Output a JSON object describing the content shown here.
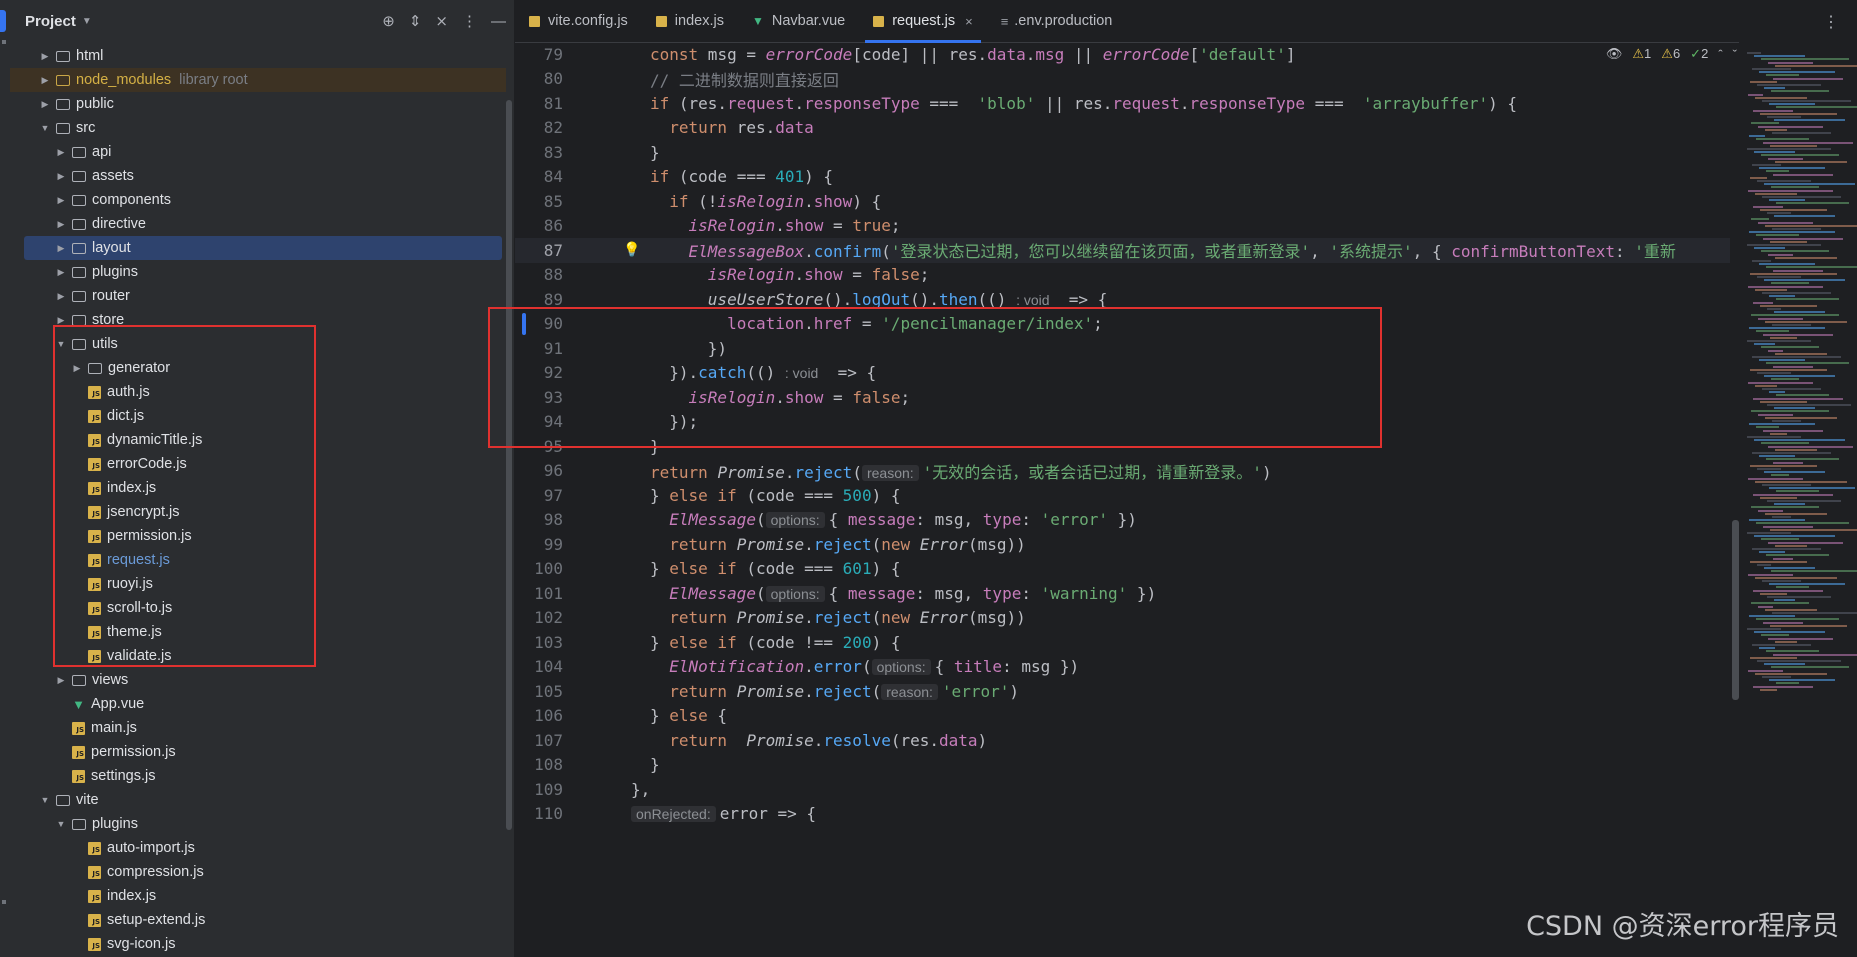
{
  "project": {
    "title": "Project",
    "tree": [
      {
        "name": "html",
        "type": "folder",
        "depth": 1,
        "arrow": "collapsed"
      },
      {
        "name": "node_modules",
        "type": "folder",
        "depth": 1,
        "arrow": "collapsed",
        "extra": "library root",
        "special": "nm"
      },
      {
        "name": "public",
        "type": "folder",
        "depth": 1,
        "arrow": "collapsed"
      },
      {
        "name": "src",
        "type": "folder",
        "depth": 1,
        "arrow": "expanded"
      },
      {
        "name": "api",
        "type": "folder",
        "depth": 2,
        "arrow": "collapsed"
      },
      {
        "name": "assets",
        "type": "folder",
        "depth": 2,
        "arrow": "collapsed"
      },
      {
        "name": "components",
        "type": "folder",
        "depth": 2,
        "arrow": "collapsed"
      },
      {
        "name": "directive",
        "type": "folder",
        "depth": 2,
        "arrow": "collapsed"
      },
      {
        "name": "layout",
        "type": "folder",
        "depth": 2,
        "arrow": "collapsed",
        "selected": true
      },
      {
        "name": "plugins",
        "type": "folder",
        "depth": 2,
        "arrow": "collapsed"
      },
      {
        "name": "router",
        "type": "folder",
        "depth": 2,
        "arrow": "collapsed"
      },
      {
        "name": "store",
        "type": "folder",
        "depth": 2,
        "arrow": "collapsed"
      },
      {
        "name": "utils",
        "type": "folder",
        "depth": 2,
        "arrow": "expanded"
      },
      {
        "name": "generator",
        "type": "folder",
        "depth": 3,
        "arrow": "collapsed"
      },
      {
        "name": "auth.js",
        "type": "js",
        "depth": 3
      },
      {
        "name": "dict.js",
        "type": "js",
        "depth": 3
      },
      {
        "name": "dynamicTitle.js",
        "type": "js",
        "depth": 3
      },
      {
        "name": "errorCode.js",
        "type": "js",
        "depth": 3
      },
      {
        "name": "index.js",
        "type": "js",
        "depth": 3
      },
      {
        "name": "jsencrypt.js",
        "type": "js",
        "depth": 3
      },
      {
        "name": "permission.js",
        "type": "js",
        "depth": 3
      },
      {
        "name": "request.js",
        "type": "js",
        "depth": 3,
        "active": true
      },
      {
        "name": "ruoyi.js",
        "type": "js",
        "depth": 3
      },
      {
        "name": "scroll-to.js",
        "type": "js",
        "depth": 3
      },
      {
        "name": "theme.js",
        "type": "js",
        "depth": 3
      },
      {
        "name": "validate.js",
        "type": "js",
        "depth": 3
      },
      {
        "name": "views",
        "type": "folder",
        "depth": 2,
        "arrow": "collapsed"
      },
      {
        "name": "App.vue",
        "type": "vue",
        "depth": 2
      },
      {
        "name": "main.js",
        "type": "js",
        "depth": 2
      },
      {
        "name": "permission.js",
        "type": "js",
        "depth": 2
      },
      {
        "name": "settings.js",
        "type": "js",
        "depth": 2
      },
      {
        "name": "vite",
        "type": "folder",
        "depth": 1,
        "arrow": "expanded"
      },
      {
        "name": "plugins",
        "type": "folder",
        "depth": 2,
        "arrow": "expanded"
      },
      {
        "name": "auto-import.js",
        "type": "js",
        "depth": 3
      },
      {
        "name": "compression.js",
        "type": "js",
        "depth": 3
      },
      {
        "name": "index.js",
        "type": "js",
        "depth": 3
      },
      {
        "name": "setup-extend.js",
        "type": "js",
        "depth": 3
      },
      {
        "name": "svg-icon.js",
        "type": "js",
        "depth": 3
      }
    ]
  },
  "tabs": [
    {
      "label": "vite.config.js",
      "icon": "js"
    },
    {
      "label": "index.js",
      "icon": "js"
    },
    {
      "label": "Navbar.vue",
      "icon": "vue"
    },
    {
      "label": "request.js",
      "icon": "js",
      "active": true,
      "close": "×"
    },
    {
      "label": ".env.production",
      "icon": "env"
    }
  ],
  "inspections": {
    "errors": "1",
    "warnings": "6",
    "ok": "2"
  },
  "current_line": 87,
  "code": [
    {
      "n": 79,
      "h": "<span class='k'>const</span> msg = <span class='it'>errorCode</span>[code] || res.<span class='p'>data</span>.<span class='p'>msg</span> || <span class='it'>errorCode</span>[<span class='s'>'default'</span>]"
    },
    {
      "n": 80,
      "h": "<span class='c'>// 二进制数据则直接返回</span>"
    },
    {
      "n": 81,
      "h": "<span class='k'>if</span> (res.<span class='p'>request</span>.<span class='p'>responseType</span> ===  <span class='s'>'blob'</span> || res.<span class='p'>request</span>.<span class='p'>responseType</span> ===  <span class='s'>'arraybuffer'</span>) {"
    },
    {
      "n": 82,
      "h": "  <span class='k'>return</span> res.<span class='p'>data</span>"
    },
    {
      "n": 83,
      "h": "}"
    },
    {
      "n": 84,
      "h": "<span class='k'>if</span> (code === <span class='n'>401</span>) {"
    },
    {
      "n": 85,
      "h": "  <span class='k'>if</span> (!<span class='it'>isRelogin</span>.<span class='p'>show</span>) {"
    },
    {
      "n": 86,
      "h": "    <span class='it'>isRelogin</span>.<span class='p'>show</span> = <span class='k'>true</span>;"
    },
    {
      "n": 87,
      "h": "    <span class='it'>ElMessageBox</span>.<span class='f'>confirm</span>(<span class='s'>'登录状态已过期，您可以继续留在该页面，或者重新登录'</span>, <span class='s'>'系统提示'</span>, { <span class='p'>confirmButtonText</span>: <span class='s'>'重新</span>"
    },
    {
      "n": 88,
      "h": "      <span class='it'>isRelogin</span>.<span class='p'>show</span> = <span class='k'>false</span>;"
    },
    {
      "n": 89,
      "h": "      <span class='gi'>useUserStore</span>().<span class='f'>logOut</span>().<span class='f'>then</span>(() <span class='hint2'>: void</span>  => {"
    },
    {
      "n": 90,
      "h": "        <span class='p'>location</span>.<span class='p'>href</span> = <span class='s'>'/pencilmanager/index'</span>;"
    },
    {
      "n": 91,
      "h": "      })"
    },
    {
      "n": 92,
      "h": "  }).<span class='f'>catch</span>(() <span class='hint2'>: void</span>  => {"
    },
    {
      "n": 93,
      "h": "    <span class='it'>isRelogin</span>.<span class='p'>show</span> = <span class='k'>false</span>;"
    },
    {
      "n": 94,
      "h": "  });"
    },
    {
      "n": 95,
      "h": "}"
    },
    {
      "n": 96,
      "h": "<span class='k'>return</span> <span class='gi'>Promise</span>.<span class='f'>reject</span>(<span class='hint'>reason:</span><span class='s'>'无效的会话，或者会话已过期，请重新登录。'</span>)"
    },
    {
      "n": 97,
      "h": "} <span class='k'>else if</span> (code === <span class='n'>500</span>) {"
    },
    {
      "n": 98,
      "h": "  <span class='it'>ElMessage</span>(<span class='hint'>options:</span>{ <span class='p'>message</span>: msg, <span class='p'>type</span>: <span class='s'>'error'</span> })"
    },
    {
      "n": 99,
      "h": "  <span class='k'>return</span> <span class='gi'>Promise</span>.<span class='f'>reject</span>(<span class='k'>new</span> <span class='gi'>Error</span>(msg))"
    },
    {
      "n": 100,
      "h": "} <span class='k'>else if</span> (code === <span class='n'>601</span>) {"
    },
    {
      "n": 101,
      "h": "  <span class='it'>ElMessage</span>(<span class='hint'>options:</span>{ <span class='p'>message</span>: msg, <span class='p'>type</span>: <span class='s'>'warning'</span> })"
    },
    {
      "n": 102,
      "h": "  <span class='k'>return</span> <span class='gi'>Promise</span>.<span class='f'>reject</span>(<span class='k'>new</span> <span class='gi'>Error</span>(msg))"
    },
    {
      "n": 103,
      "h": "} <span class='k'>else if</span> (code !== <span class='n'>200</span>) {"
    },
    {
      "n": 104,
      "h": "  <span class='it'>ElNotification</span>.<span class='f'>error</span>(<span class='hint'>options:</span>{ <span class='p'>title</span>: msg })"
    },
    {
      "n": 105,
      "h": "  <span class='k'>return</span> <span class='gi'>Promise</span>.<span class='f'>reject</span>(<span class='hint'>reason:</span><span class='s'>'error'</span>)"
    },
    {
      "n": 106,
      "h": "} <span class='k'>else</span> {"
    },
    {
      "n": 107,
      "h": "  <span class='k'>return</span>  <span class='gi'>Promise</span>.<span class='f'>resolve</span>(res.<span class='p'>data</span>)"
    },
    {
      "n": 108,
      "h": "}"
    },
    {
      "n": 109,
      "h": "<span style='margin-left:-19px'>},</span>"
    },
    {
      "n": 110,
      "h": "<span style='margin-left:-19px'><span class='hint'>onRejected:</span>error => {</span>"
    }
  ],
  "watermark": "CSDN @资深error程序员",
  "colors": {
    "accent": "#3574f0",
    "annotation": "#e0312f",
    "bg": "#1e1f22",
    "panel": "#2b2d30"
  }
}
